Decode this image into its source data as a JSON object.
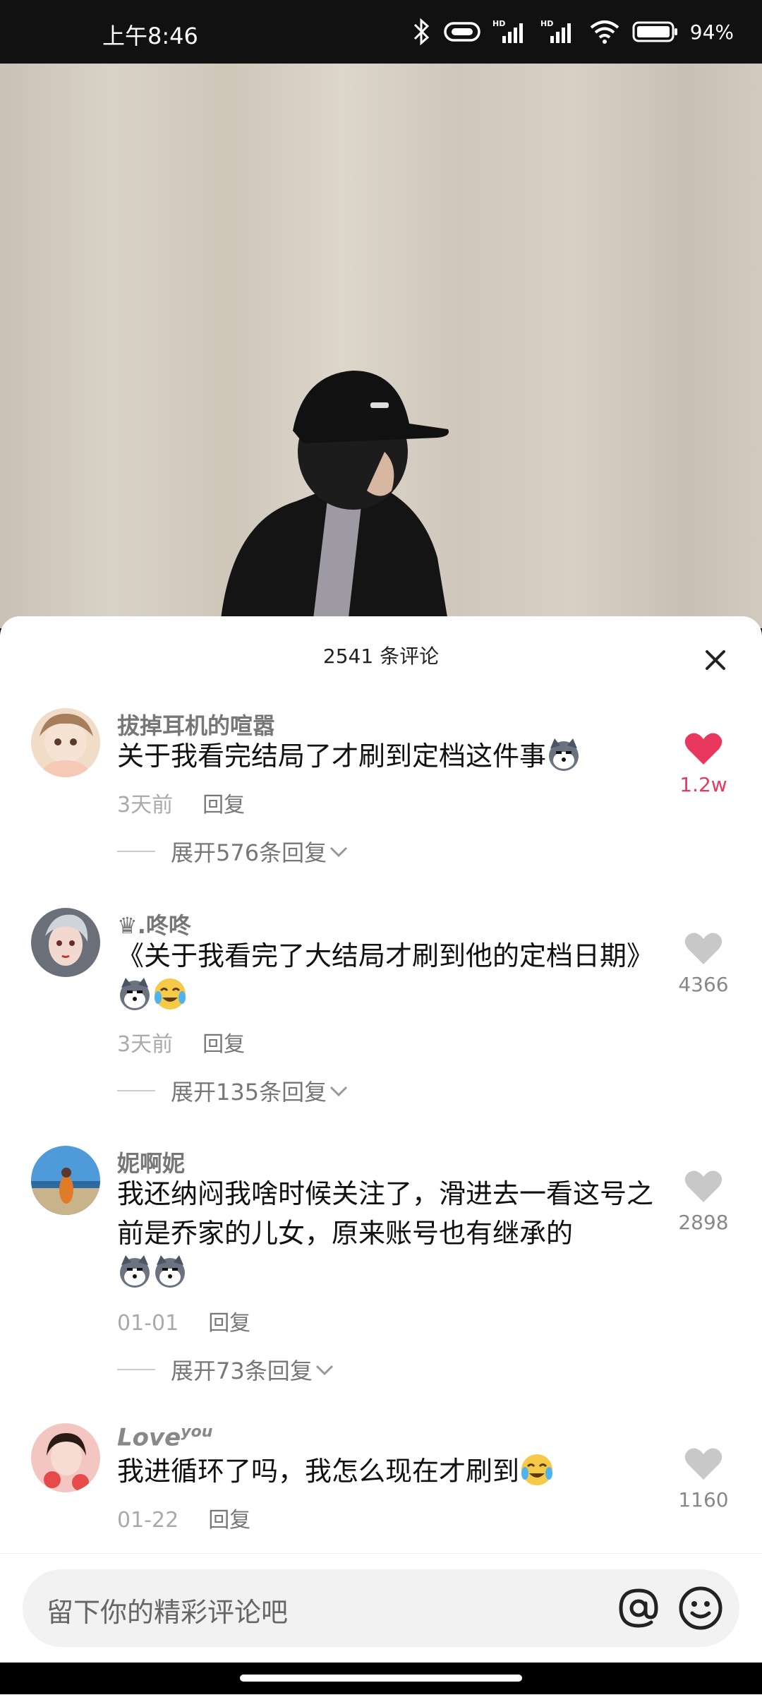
{
  "status_bar": {
    "time": "上午8:46",
    "battery": "94%"
  },
  "sheet": {
    "title": "2541 条评论"
  },
  "comments": [
    {
      "username": "拔掉耳机的喧嚣",
      "text": "关于我看完结局了才刷到定档这件事",
      "time": "3天前",
      "reply_label": "回复",
      "expand_label": "展开576条回复",
      "likes": "1.2w",
      "liked": true
    },
    {
      "username": "♛.咚咚",
      "text": "《关于我看完了大结局才刷到他的定档日期》",
      "time": "3天前",
      "reply_label": "回复",
      "expand_label": "展开135条回复",
      "likes": "4366",
      "liked": false
    },
    {
      "username": "妮啊妮",
      "text": "我还纳闷我啥时候关注了，滑进去一看这号之前是乔家的儿女，原来账号也有继承的",
      "time": "01-01",
      "reply_label": "回复",
      "expand_label": "展开73条回复",
      "likes": "2898",
      "liked": false
    },
    {
      "username": "Love",
      "username_sup": "you",
      "text": "我进循环了吗，我怎么现在才刷到",
      "time": "01-22",
      "reply_label": "回复",
      "likes": "1160",
      "liked": false
    }
  ],
  "input": {
    "placeholder": "留下你的精彩评论吧"
  },
  "colors": {
    "like_active": "#e8385d",
    "like_inactive": "#c8c8c8"
  }
}
